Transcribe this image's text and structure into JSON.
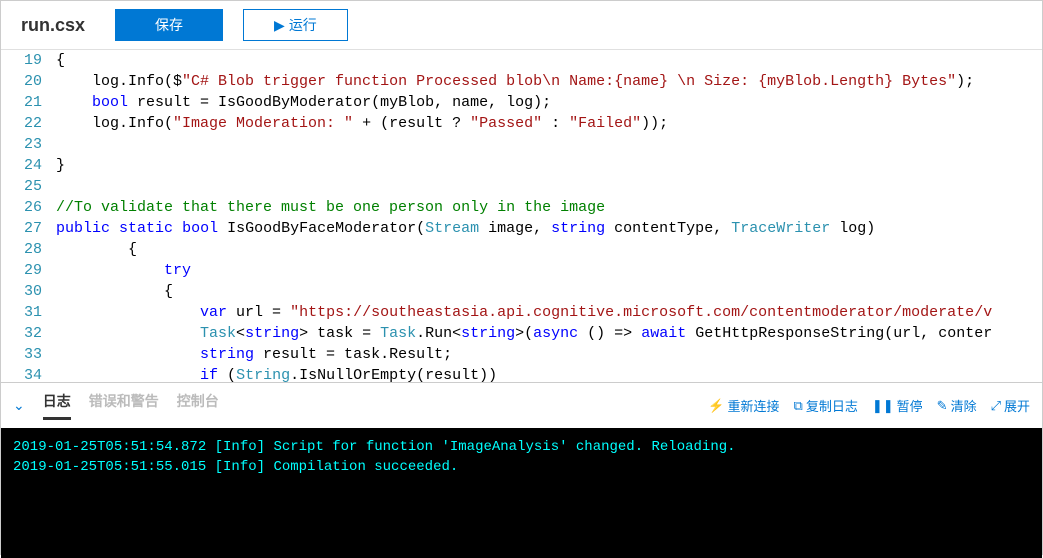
{
  "toolbar": {
    "filename": "run.csx",
    "save_label": "保存",
    "run_label": "运行"
  },
  "editor": {
    "lines": [
      {
        "n": 19,
        "raw": "{"
      },
      {
        "n": 20,
        "raw": "    log.Info($\"C# Blob trigger function Processed blob\\n Name:{name} \\n Size: {myBlob.Length} Bytes\");"
      },
      {
        "n": 21,
        "raw": "    bool result = IsGoodByModerator(myBlob, name, log);"
      },
      {
        "n": 22,
        "raw": "    log.Info(\"Image Moderation: \" + (result ? \"Passed\" : \"Failed\"));"
      },
      {
        "n": 23,
        "raw": ""
      },
      {
        "n": 24,
        "raw": "}"
      },
      {
        "n": 25,
        "raw": ""
      },
      {
        "n": 26,
        "raw": "//To validate that there must be one person only in the image"
      },
      {
        "n": 27,
        "raw": "public static bool IsGoodByFaceModerator(Stream image, string contentType, TraceWriter log)"
      },
      {
        "n": 28,
        "raw": "        {"
      },
      {
        "n": 29,
        "raw": "            try"
      },
      {
        "n": 30,
        "raw": "            {"
      },
      {
        "n": 31,
        "raw": "                var url = \"https://southeastasia.api.cognitive.microsoft.com/contentmoderator/moderate/v"
      },
      {
        "n": 32,
        "raw": "                Task<string> task = Task.Run<string>(async () => await GetHttpResponseString(url, conter"
      },
      {
        "n": 33,
        "raw": "                string result = task.Result;"
      },
      {
        "n": 34,
        "raw": "                if (String.IsNullOrEmpty(result))"
      }
    ],
    "top_partial_line_num": 18
  },
  "panel": {
    "tabs": {
      "logs": "日志",
      "errors": "错误和警告",
      "console": "控制台"
    },
    "actions": {
      "reconnect": "重新连接",
      "copy": "复制日志",
      "pause": "暂停",
      "clear": "清除",
      "expand": "展开"
    }
  },
  "console": {
    "lines": [
      "2019-01-25T05:51:54.872 [Info] Script for function 'ImageAnalysis' changed. Reloading.",
      "2019-01-25T05:51:55.015 [Info] Compilation succeeded."
    ]
  }
}
